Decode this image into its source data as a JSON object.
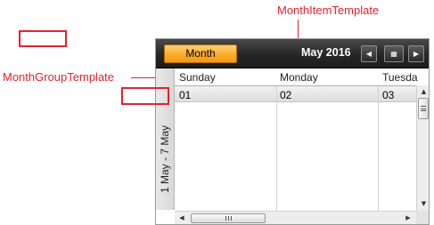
{
  "callouts": {
    "month_item": "MonthItemTemplate",
    "month_group": "MonthGroupTemplate"
  },
  "toolbar": {
    "view_button": "Month",
    "date": "May 2016",
    "prev_icon": "◀",
    "today_icon": "▦",
    "next_icon": "▶"
  },
  "group": {
    "label": "1 May - 7 May"
  },
  "days": [
    "Sunday",
    "Monday",
    "Tuesda"
  ],
  "day_numbers": [
    "01",
    "02",
    "03"
  ],
  "scroll": {
    "up": "▲",
    "down": "▼",
    "left": "◀",
    "right": "▶"
  },
  "colors": {
    "callout": "#e0242e",
    "view_button": "#fbab28",
    "toolbar": "#262626"
  },
  "icons": [
    "chevron-left-icon",
    "calendar-grid-icon",
    "chevron-right-icon",
    "arrow-up-icon",
    "arrow-down-icon",
    "arrow-left-icon",
    "arrow-right-icon",
    "grip-icon"
  ]
}
